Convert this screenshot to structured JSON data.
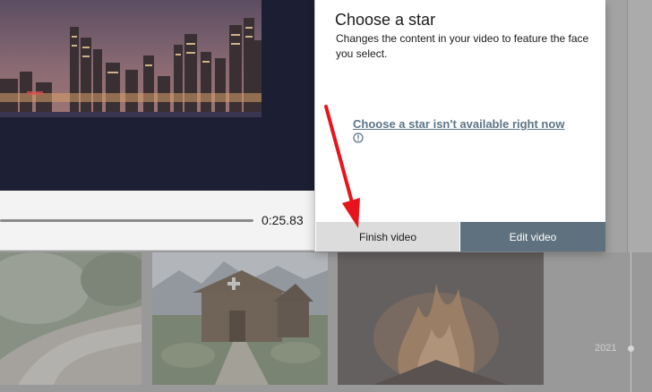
{
  "player": {
    "time": "0:25.83",
    "progress": 0.97
  },
  "dialog": {
    "title": "Choose a star",
    "description": "Changes the content in your video to feature the face you select.",
    "unavailable_link": "Choose a star isn't available right now",
    "finish_label": "Finish video",
    "edit_label": "Edit video",
    "accent_color": "#5f717e",
    "link_color": "#5e7586"
  },
  "timeline": {
    "year": "2021"
  },
  "annotation": {
    "arrow_color": "#e8141c"
  },
  "icons": [
    "info-icon",
    "red-arrow-annotation"
  ]
}
